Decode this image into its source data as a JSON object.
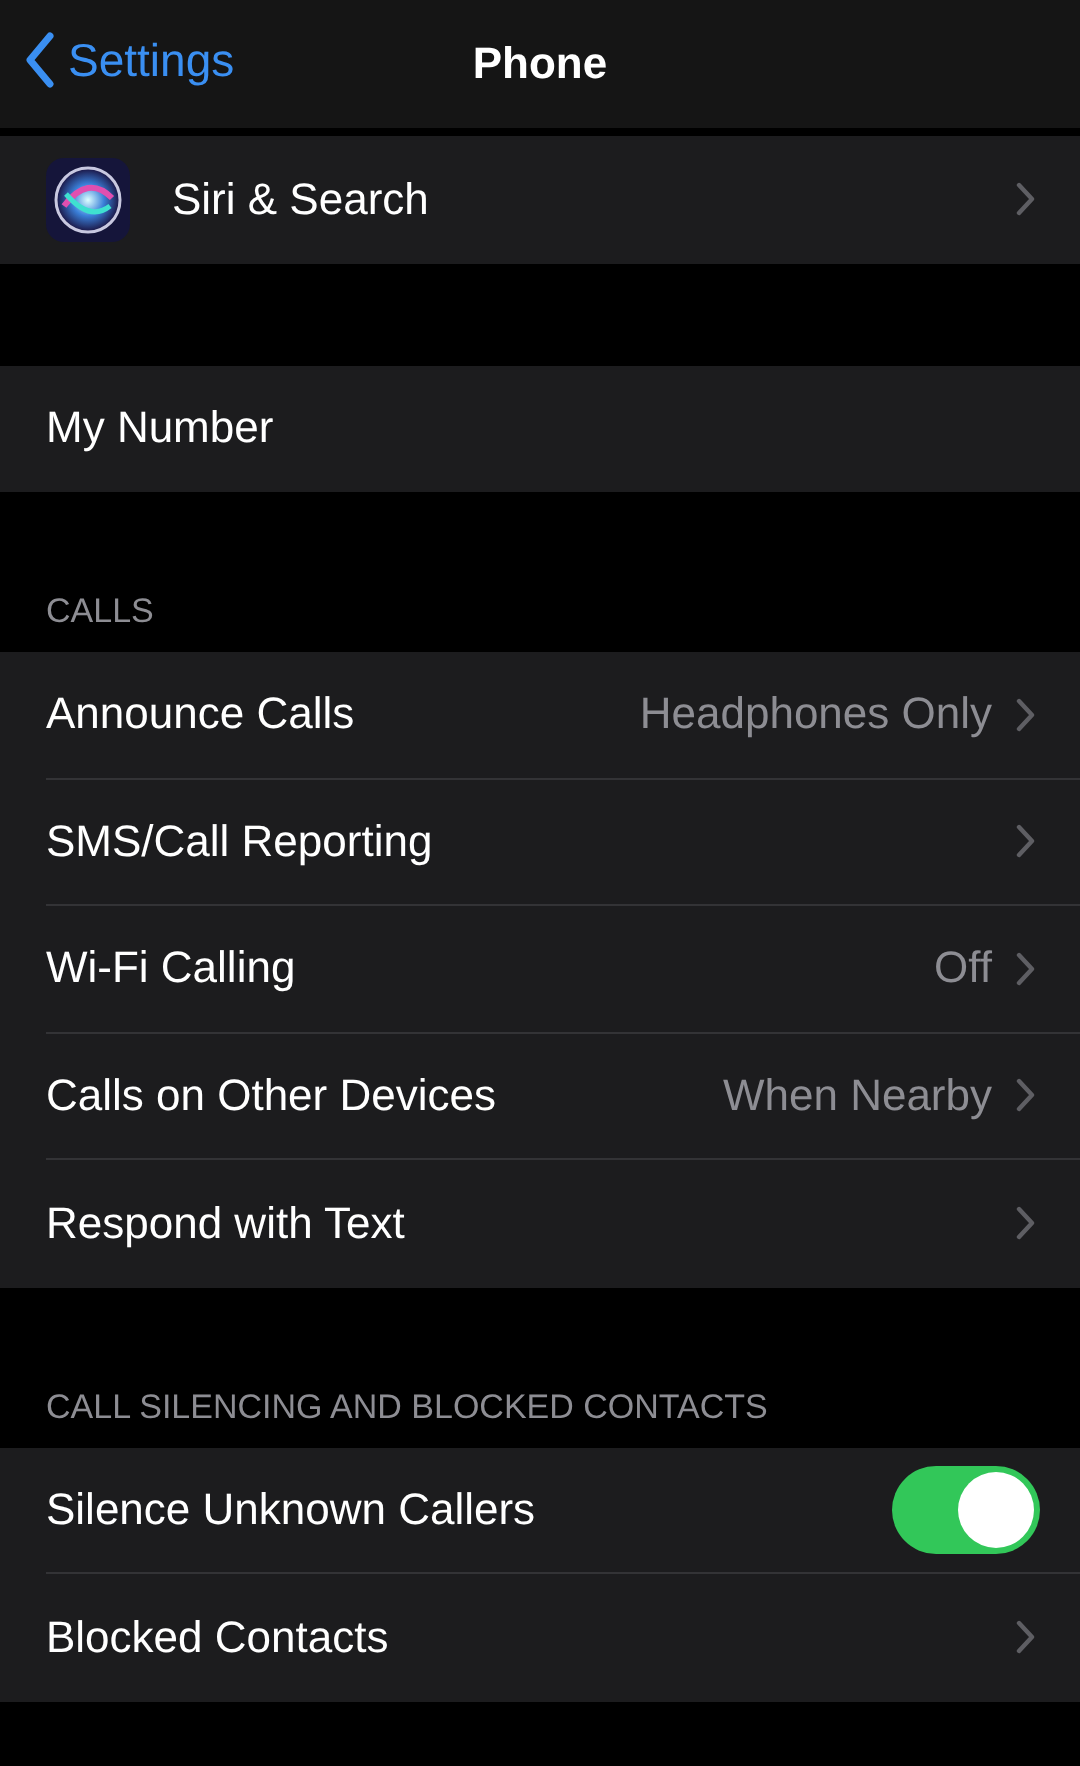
{
  "nav": {
    "back": "Settings",
    "title": "Phone"
  },
  "sections": [
    {
      "rows": [
        {
          "kind": "app",
          "label": "Siri & Search"
        }
      ]
    },
    {
      "rows": [
        {
          "kind": "plain",
          "label": "My Number"
        }
      ]
    },
    {
      "header": "CALLS",
      "rows": [
        {
          "kind": "link",
          "label": "Announce Calls",
          "value": "Headphones Only"
        },
        {
          "kind": "link",
          "label": "SMS/Call Reporting"
        },
        {
          "kind": "link",
          "label": "Wi-Fi Calling",
          "value": "Off"
        },
        {
          "kind": "link",
          "label": "Calls on Other Devices",
          "value": "When Nearby"
        },
        {
          "kind": "link",
          "label": "Respond with Text"
        }
      ]
    },
    {
      "header": "CALL SILENCING AND BLOCKED CONTACTS",
      "rows": [
        {
          "kind": "toggle",
          "label": "Silence Unknown Callers",
          "on": true
        },
        {
          "kind": "link",
          "label": "Blocked Contacts"
        }
      ]
    }
  ]
}
